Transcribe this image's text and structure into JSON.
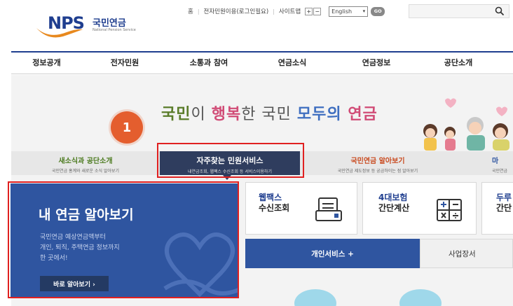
{
  "logo": {
    "mark": "NPS",
    "name_kr": "국민연금",
    "name_en": "National Pension Service"
  },
  "util": {
    "links": [
      "홈",
      "전자민원이용(로그인필요)",
      "사이트맵"
    ],
    "zoom_in": "+",
    "zoom_out": "−",
    "language": "English",
    "go_label": "GO",
    "search_placeholder": ""
  },
  "gnb": [
    "정보공개",
    "전자민원",
    "소통과 참여",
    "연금소식",
    "연금정보",
    "공단소개"
  ],
  "banner": {
    "slogan": {
      "part1": "국민",
      "part2": "이 ",
      "part3": "행복",
      "part4": "한 국민 ",
      "part5": "모두의",
      "part6": " 연금"
    },
    "badge": "1"
  },
  "tabs": [
    {
      "title": "새소식과 공단소개",
      "desc": "국민연금 홍계와 새로운 소식 알아보기"
    },
    {
      "title": "자주찾는 민원서비스",
      "desc": "내연금조회, 웹팩스 수신조회 등 서비스이용하기"
    },
    {
      "title": "국민연금 알아보기",
      "desc": "국민연금 제도정보 등 궁금하이는 점 알아보기"
    },
    {
      "title": "마",
      "desc": "국민연금"
    }
  ],
  "card": {
    "title": "내 연금 알아보기",
    "desc": [
      "국민연금 예상연금액부터",
      "개인, 퇴직, 주택연금 정보까지",
      "한 곳에서!"
    ],
    "button": "바로 알아보기 ›"
  },
  "services": [
    {
      "line1": "웹팩스",
      "line2": "수신조회",
      "icon": "fax-icon"
    },
    {
      "line1": "4대보험",
      "line2": "간단계산",
      "icon": "calculator-icon"
    },
    {
      "line1": "두루",
      "line2": "간단",
      "icon": "none"
    }
  ],
  "service_tabs": {
    "personal": "개인서비스 +",
    "business": "사업장서"
  },
  "colors": {
    "brand": "#1f3e8f",
    "card": "#2f55a0",
    "active_tab": "#2f3d5e",
    "highlight": "#e02020",
    "badge": "#e45e2e"
  }
}
